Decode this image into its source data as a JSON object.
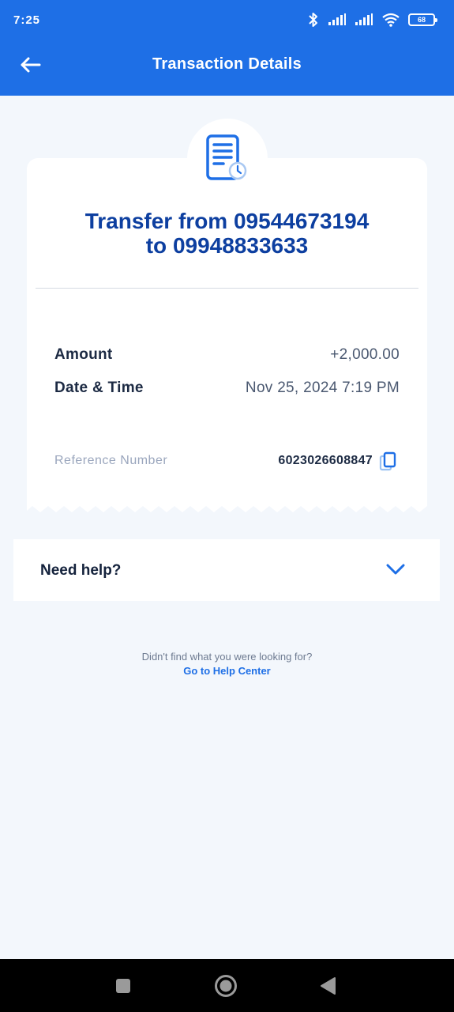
{
  "status_bar": {
    "time": "7:25",
    "battery": "68"
  },
  "header": {
    "title": "Transaction Details"
  },
  "transaction": {
    "title_line1": "Transfer from 09544673194",
    "title_line2": "to 09948833633",
    "amount_label": "Amount",
    "amount_value": "+2,000.00",
    "datetime_label": "Date & Time",
    "datetime_value": "Nov 25, 2024 7:19 PM",
    "reference_label": "Reference Number",
    "reference_value": "6023026608847"
  },
  "help": {
    "panel_label": "Need help?",
    "prompt": "Didn't find what you were looking for?",
    "link": "Go to Help Center"
  },
  "colors": {
    "brand_blue": "#1e6fe6",
    "title_blue": "#0d3fa0",
    "background": "#f3f7fc"
  },
  "icons": {
    "back": "arrow-left-icon",
    "receipt": "receipt-clock-icon",
    "copy": "copy-icon",
    "expand": "chevron-down-icon"
  }
}
